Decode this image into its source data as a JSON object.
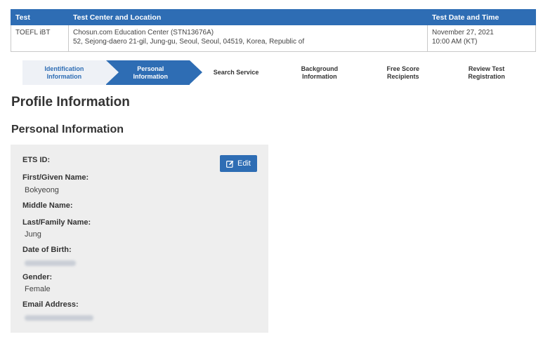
{
  "test_table": {
    "headers": [
      "Test",
      "Test Center and Location",
      "Test Date and Time"
    ],
    "row": {
      "test": "TOEFL iBT",
      "center_name": "Chosun.com Education Center (STN13676A)",
      "center_address": "52, Sejong-daero 21-gil,  Jung-gu,  Seoul,  Seoul,  04519,  Korea, Republic of",
      "date": "November 27, 2021",
      "time": "10:00 AM (KT)"
    }
  },
  "stepper": {
    "steps": [
      {
        "line1": "Identification",
        "line2": "Information",
        "state": "done"
      },
      {
        "line1": "Personal",
        "line2": "Information",
        "state": "current"
      },
      {
        "line1": "Search Service",
        "line2": "",
        "state": "future"
      },
      {
        "line1": "Background",
        "line2": "Information",
        "state": "future"
      },
      {
        "line1": "Free Score",
        "line2": "Recipients",
        "state": "future"
      },
      {
        "line1": "Review Test",
        "line2": "Registration",
        "state": "future"
      }
    ]
  },
  "profile_title": "Profile Information",
  "personal_title": "Personal Information",
  "card": {
    "edit_label": "Edit",
    "edit_icon": "edit-icon",
    "fields": {
      "ets_id_label": "ETS ID:",
      "first_name_label": "First/Given Name:",
      "first_name_value": "Bokyeong",
      "middle_name_label": "Middle Name:",
      "last_name_label": "Last/Family Name:",
      "last_name_value": "Jung",
      "dob_label": "Date of Birth:",
      "gender_label": "Gender:",
      "gender_value": "Female",
      "email_label": "Email Address:"
    }
  },
  "colors": {
    "accent": "#2e6db4",
    "step_done_bg": "#eef1f6",
    "card_bg": "#eeeeee"
  }
}
